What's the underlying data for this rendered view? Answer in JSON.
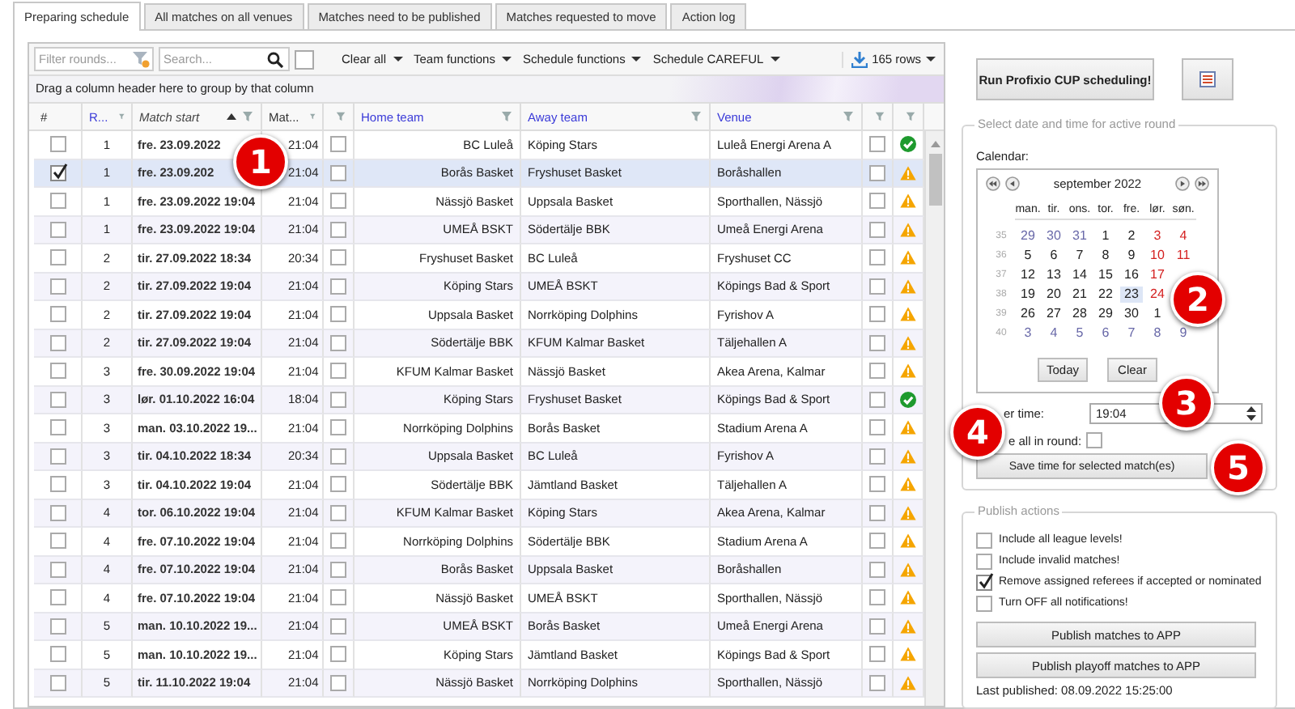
{
  "tabs": [
    {
      "label": "Preparing schedule",
      "selected": true
    },
    {
      "label": "All matches on all venues",
      "selected": false
    },
    {
      "label": "Matches need to be published",
      "selected": false
    },
    {
      "label": "Matches requested to move",
      "selected": false
    },
    {
      "label": "Action log",
      "selected": false
    }
  ],
  "toolbar": {
    "filter_placeholder": "Filter rounds...",
    "search_placeholder": "Search...",
    "select_all_checked": false,
    "menus": [
      "Clear all",
      "Team functions",
      "Schedule functions",
      "Schedule CAREFUL"
    ],
    "row_count": "165 rows"
  },
  "group_hint": "Drag a column header here to group by that column",
  "columns": [
    {
      "label": "#",
      "filtered": false,
      "sorted": false
    },
    {
      "label": "R...",
      "filtered": true,
      "sorted": false
    },
    {
      "label": "Match start",
      "filtered": false,
      "sorted": true
    },
    {
      "label": "Mat...",
      "filtered": false,
      "sorted": false
    },
    {
      "filtered": false,
      "sorted": false
    },
    {
      "label": "Home team",
      "filtered": true,
      "sorted": false
    },
    {
      "label": "Away team",
      "filtered": true,
      "sorted": false
    },
    {
      "label": "Venue",
      "filtered": true,
      "sorted": false
    },
    {
      "filtered": false,
      "sorted": false
    },
    {
      "filtered": false,
      "sorted": false
    }
  ],
  "rows": [
    {
      "checked": false,
      "selected": false,
      "round": "1",
      "start": "fre. 23.09.2022",
      "end": "21:04",
      "flag": false,
      "home": "BC Luleå",
      "away": "Köping Stars",
      "venue": "Luleå Energi Arena A",
      "published": false,
      "kind": "ok"
    },
    {
      "checked": true,
      "selected": true,
      "round": "1",
      "start": "fre. 23.09.202",
      "end": "21:04",
      "flag": false,
      "home": "Borås Basket",
      "away": "Fryshuset Basket",
      "venue": "Boråshallen",
      "published": false,
      "kind": "warn"
    },
    {
      "checked": false,
      "selected": false,
      "round": "1",
      "start": "fre. 23.09.2022 19:04",
      "end": "21:04",
      "flag": false,
      "home": "Nässjö Basket",
      "away": "Uppsala Basket",
      "venue": "Sporthallen, Nässjö",
      "published": false,
      "kind": "warn"
    },
    {
      "checked": false,
      "selected": false,
      "round": "1",
      "start": "fre. 23.09.2022 19:04",
      "end": "21:04",
      "flag": false,
      "home": "UMEÅ BSKT",
      "away": "Södertälje BBK",
      "venue": "Umeå Energi Arena",
      "published": false,
      "kind": "warn"
    },
    {
      "checked": false,
      "selected": false,
      "round": "2",
      "start": "tir. 27.09.2022 18:34",
      "end": "20:34",
      "flag": false,
      "home": "Fryshuset Basket",
      "away": "BC Luleå",
      "venue": "Fryshuset CC",
      "published": false,
      "kind": "warn"
    },
    {
      "checked": false,
      "selected": false,
      "round": "2",
      "start": "tir. 27.09.2022 19:04",
      "end": "21:04",
      "flag": false,
      "home": "Köping Stars",
      "away": "UMEÅ BSKT",
      "venue": "Köpings Bad & Sport",
      "published": false,
      "kind": "warn"
    },
    {
      "checked": false,
      "selected": false,
      "round": "2",
      "start": "tir. 27.09.2022 19:04",
      "end": "21:04",
      "flag": false,
      "home": "Uppsala Basket",
      "away": "Norrköping Dolphins",
      "venue": "Fyrishov A",
      "published": false,
      "kind": "warn"
    },
    {
      "checked": false,
      "selected": false,
      "round": "2",
      "start": "tir. 27.09.2022 19:04",
      "end": "21:04",
      "flag": false,
      "home": "Södertälje BBK",
      "away": "KFUM Kalmar Basket",
      "venue": "Täljehallen A",
      "published": false,
      "kind": "warn"
    },
    {
      "checked": false,
      "selected": false,
      "round": "3",
      "start": "fre. 30.09.2022 19:04",
      "end": "21:04",
      "flag": false,
      "home": "KFUM Kalmar Basket",
      "away": "Nässjö Basket",
      "venue": "Akea Arena, Kalmar",
      "published": false,
      "kind": "warn"
    },
    {
      "checked": false,
      "selected": false,
      "round": "3",
      "start": "lør. 01.10.2022 16:04",
      "end": "18:04",
      "flag": false,
      "home": "Köping Stars",
      "away": "Fryshuset Basket",
      "venue": "Köpings Bad & Sport",
      "published": false,
      "kind": "ok"
    },
    {
      "checked": false,
      "selected": false,
      "round": "3",
      "start": "man. 03.10.2022 19...",
      "end": "21:04",
      "flag": false,
      "home": "Norrköping Dolphins",
      "away": "Borås Basket",
      "venue": "Stadium Arena A",
      "published": false,
      "kind": "warn"
    },
    {
      "checked": false,
      "selected": false,
      "round": "3",
      "start": "tir. 04.10.2022 18:34",
      "end": "20:34",
      "flag": false,
      "home": "Uppsala Basket",
      "away": "BC Luleå",
      "venue": "Fyrishov A",
      "published": false,
      "kind": "warn"
    },
    {
      "checked": false,
      "selected": false,
      "round": "3",
      "start": "tir. 04.10.2022 19:04",
      "end": "21:04",
      "flag": false,
      "home": "Södertälje BBK",
      "away": "Jämtland Basket",
      "venue": "Täljehallen A",
      "published": false,
      "kind": "warn"
    },
    {
      "checked": false,
      "selected": false,
      "round": "4",
      "start": "tor. 06.10.2022 19:04",
      "end": "21:04",
      "flag": false,
      "home": "KFUM Kalmar Basket",
      "away": "Köping Stars",
      "venue": "Akea Arena, Kalmar",
      "published": false,
      "kind": "warn"
    },
    {
      "checked": false,
      "selected": false,
      "round": "4",
      "start": "fre. 07.10.2022 19:04",
      "end": "21:04",
      "flag": false,
      "home": "Norrköping Dolphins",
      "away": "Södertälje BBK",
      "venue": "Stadium Arena A",
      "published": false,
      "kind": "warn"
    },
    {
      "checked": false,
      "selected": false,
      "round": "4",
      "start": "fre. 07.10.2022 19:04",
      "end": "21:04",
      "flag": false,
      "home": "Borås Basket",
      "away": "Uppsala Basket",
      "venue": "Boråshallen",
      "published": false,
      "kind": "warn"
    },
    {
      "checked": false,
      "selected": false,
      "round": "4",
      "start": "fre. 07.10.2022 19:04",
      "end": "21:04",
      "flag": false,
      "home": "Nässjö Basket",
      "away": "UMEÅ BSKT",
      "venue": "Sporthallen, Nässjö",
      "published": false,
      "kind": "warn"
    },
    {
      "checked": false,
      "selected": false,
      "round": "5",
      "start": "man. 10.10.2022 19...",
      "end": "21:04",
      "flag": false,
      "home": "UMEÅ BSKT",
      "away": "Borås Basket",
      "venue": "Umeå Energi Arena",
      "published": false,
      "kind": "warn"
    },
    {
      "checked": false,
      "selected": false,
      "round": "5",
      "start": "man. 10.10.2022 19...",
      "end": "21:04",
      "flag": false,
      "home": "Köping Stars",
      "away": "Jämtland Basket",
      "venue": "Köpings Bad & Sport",
      "published": false,
      "kind": "warn"
    },
    {
      "checked": false,
      "selected": false,
      "round": "5",
      "start": "tir. 11.10.2022 19:04",
      "end": "21:04",
      "flag": false,
      "home": "Nässjö Basket",
      "away": "Norrköping Dolphins",
      "venue": "Sporthallen, Nässjö",
      "published": false,
      "kind": "warn"
    }
  ],
  "run_button": "Run Profixio CUP scheduling!",
  "round_panel": {
    "legend": "Select date and time for active round",
    "calendar_label": "Calendar:",
    "calendar": {
      "month": "september 2022",
      "weekdays": [
        "man.",
        "tir.",
        "ons.",
        "tor.",
        "fre.",
        "lør.",
        "søn."
      ],
      "weeks": [
        {
          "number": "35",
          "days": [
            {
              "d": "29",
              "kind": "other",
              "selected": false
            },
            {
              "d": "30",
              "kind": "other",
              "selected": false
            },
            {
              "d": "31",
              "kind": "other",
              "selected": false
            },
            {
              "d": "1",
              "kind": "day",
              "selected": false
            },
            {
              "d": "2",
              "kind": "day",
              "selected": false
            },
            {
              "d": "3",
              "kind": "weekend",
              "selected": false
            },
            {
              "d": "4",
              "kind": "weekend",
              "selected": false
            }
          ]
        },
        {
          "number": "36",
          "days": [
            {
              "d": "5",
              "kind": "day",
              "selected": false
            },
            {
              "d": "6",
              "kind": "day",
              "selected": false
            },
            {
              "d": "7",
              "kind": "day",
              "selected": false
            },
            {
              "d": "8",
              "kind": "day",
              "selected": false
            },
            {
              "d": "9",
              "kind": "day",
              "selected": false
            },
            {
              "d": "10",
              "kind": "weekend",
              "selected": false
            },
            {
              "d": "11",
              "kind": "weekend",
              "selected": false
            }
          ]
        },
        {
          "number": "37",
          "days": [
            {
              "d": "12",
              "kind": "day",
              "selected": false
            },
            {
              "d": "13",
              "kind": "day",
              "selected": false
            },
            {
              "d": "14",
              "kind": "day",
              "selected": false
            },
            {
              "d": "15",
              "kind": "day",
              "selected": false
            },
            {
              "d": "16",
              "kind": "day",
              "selected": false
            },
            {
              "d": "17",
              "kind": "weekend",
              "selected": false
            }
          ]
        },
        {
          "number": "38",
          "days": [
            {
              "d": "19",
              "kind": "day",
              "selected": false
            },
            {
              "d": "20",
              "kind": "day",
              "selected": false
            },
            {
              "d": "21",
              "kind": "day",
              "selected": false
            },
            {
              "d": "22",
              "kind": "day",
              "selected": false
            },
            {
              "d": "23",
              "kind": "day",
              "selected": true
            },
            {
              "d": "24",
              "kind": "weekend",
              "selected": false
            }
          ]
        },
        {
          "number": "39",
          "days": [
            {
              "d": "26",
              "kind": "day",
              "selected": false
            },
            {
              "d": "27",
              "kind": "day",
              "selected": false
            },
            {
              "d": "28",
              "kind": "day",
              "selected": false
            },
            {
              "d": "29",
              "kind": "day",
              "selected": false
            },
            {
              "d": "30",
              "kind": "day",
              "selected": false
            },
            {
              "d": "1",
              "kind": "day",
              "selected": false
            }
          ]
        },
        {
          "number": "40",
          "days": [
            {
              "d": "3",
              "kind": "other",
              "selected": false
            },
            {
              "d": "4",
              "kind": "other",
              "selected": false
            },
            {
              "d": "5",
              "kind": "other",
              "selected": false
            },
            {
              "d": "6",
              "kind": "other",
              "selected": false
            },
            {
              "d": "7",
              "kind": "other",
              "selected": false
            },
            {
              "d": "8",
              "kind": "other",
              "selected": false
            },
            {
              "d": "9",
              "kind": "other",
              "selected": false
            }
          ]
        }
      ],
      "buttons": [
        "Today",
        "Clear"
      ]
    },
    "time_label": "er time:",
    "time_value": "19:04",
    "apply_label": "e all in round:",
    "apply_checked": false,
    "save_button": "Save time for selected match(es)"
  },
  "publish_panel": {
    "legend": "Publish actions",
    "options": [
      {
        "label": "Include all league levels!",
        "checked": false
      },
      {
        "label": "Include invalid matches!",
        "checked": false
      },
      {
        "label": "Remove assigned referees if accepted or nominated",
        "checked": true
      },
      {
        "label": "Turn OFF all notifications!",
        "checked": false
      }
    ],
    "buttons": [
      "Publish matches to APP",
      "Publish playoff matches to APP"
    ],
    "last_published": "Last published: 08.09.2022 15:25:00"
  },
  "callouts": [
    "1",
    "2",
    "3",
    "4",
    "5"
  ]
}
